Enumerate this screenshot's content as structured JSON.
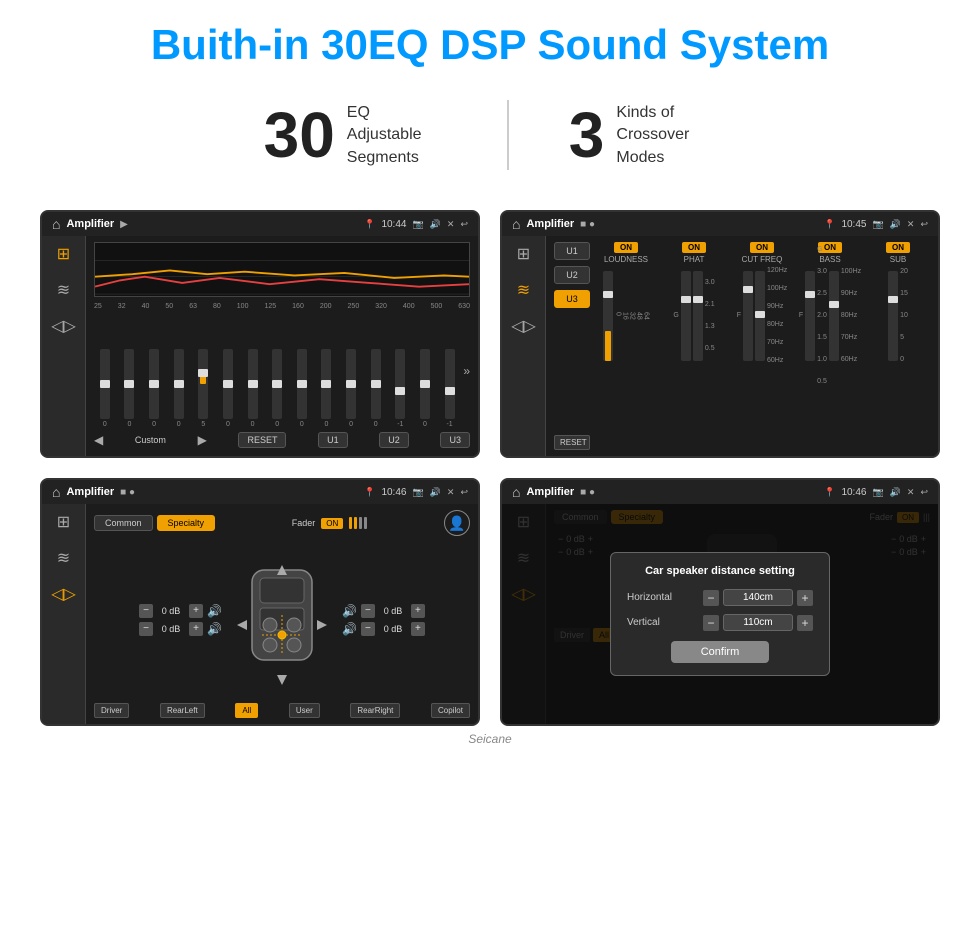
{
  "page": {
    "title": "Buith-in 30EQ DSP Sound System",
    "stats": [
      {
        "number": "30",
        "desc_line1": "EQ Adjustable",
        "desc_line2": "Segments"
      },
      {
        "number": "3",
        "desc_line1": "Kinds of",
        "desc_line2": "Crossover Modes"
      }
    ],
    "watermark": "Seicane"
  },
  "screens": {
    "eq_screen": {
      "status_time": "10:44",
      "app_title": "Amplifier",
      "freq_labels": [
        "25",
        "32",
        "40",
        "50",
        "63",
        "80",
        "100",
        "125",
        "160",
        "200",
        "250",
        "320",
        "400",
        "500",
        "630"
      ],
      "eq_values": [
        "0",
        "0",
        "0",
        "0",
        "5",
        "0",
        "0",
        "0",
        "0",
        "0",
        "0",
        "0",
        "-1",
        "0",
        "-1"
      ],
      "eq_positions": [
        50,
        50,
        50,
        50,
        30,
        50,
        50,
        50,
        50,
        50,
        50,
        50,
        60,
        50,
        60
      ],
      "bottom_buttons": [
        "RESET",
        "U1",
        "U2",
        "U3"
      ],
      "current_preset": "Custom"
    },
    "crossover_screen": {
      "status_time": "10:45",
      "app_title": "Amplifier",
      "presets": [
        "U1",
        "U2",
        "U3"
      ],
      "active_preset": "U3",
      "channels": [
        {
          "name": "LOUDNESS",
          "toggle": "ON"
        },
        {
          "name": "PHAT",
          "toggle": "ON"
        },
        {
          "name": "CUT FREQ",
          "toggle": "ON"
        },
        {
          "name": "BASS",
          "toggle": "ON"
        },
        {
          "name": "SUB",
          "toggle": "ON"
        }
      ],
      "reset_label": "RESET"
    },
    "specialty_screen": {
      "status_time": "10:46",
      "app_title": "Amplifier",
      "tabs": [
        "Common",
        "Specialty"
      ],
      "active_tab": "Specialty",
      "fader_label": "Fader",
      "fader_on": "ON",
      "dB_values": [
        "0 dB",
        "0 dB",
        "0 dB",
        "0 dB"
      ],
      "speaker_positions": [
        "Driver",
        "RearLeft",
        "All",
        "User",
        "RearRight",
        "Copilot"
      ]
    },
    "distance_screen": {
      "status_time": "10:46",
      "app_title": "Amplifier",
      "tabs": [
        "Common",
        "Specialty"
      ],
      "active_tab": "Specialty",
      "dialog": {
        "title": "Car speaker distance setting",
        "horizontal_label": "Horizontal",
        "horizontal_value": "140cm",
        "vertical_label": "Vertical",
        "vertical_value": "110cm",
        "confirm_label": "Confirm"
      }
    }
  }
}
